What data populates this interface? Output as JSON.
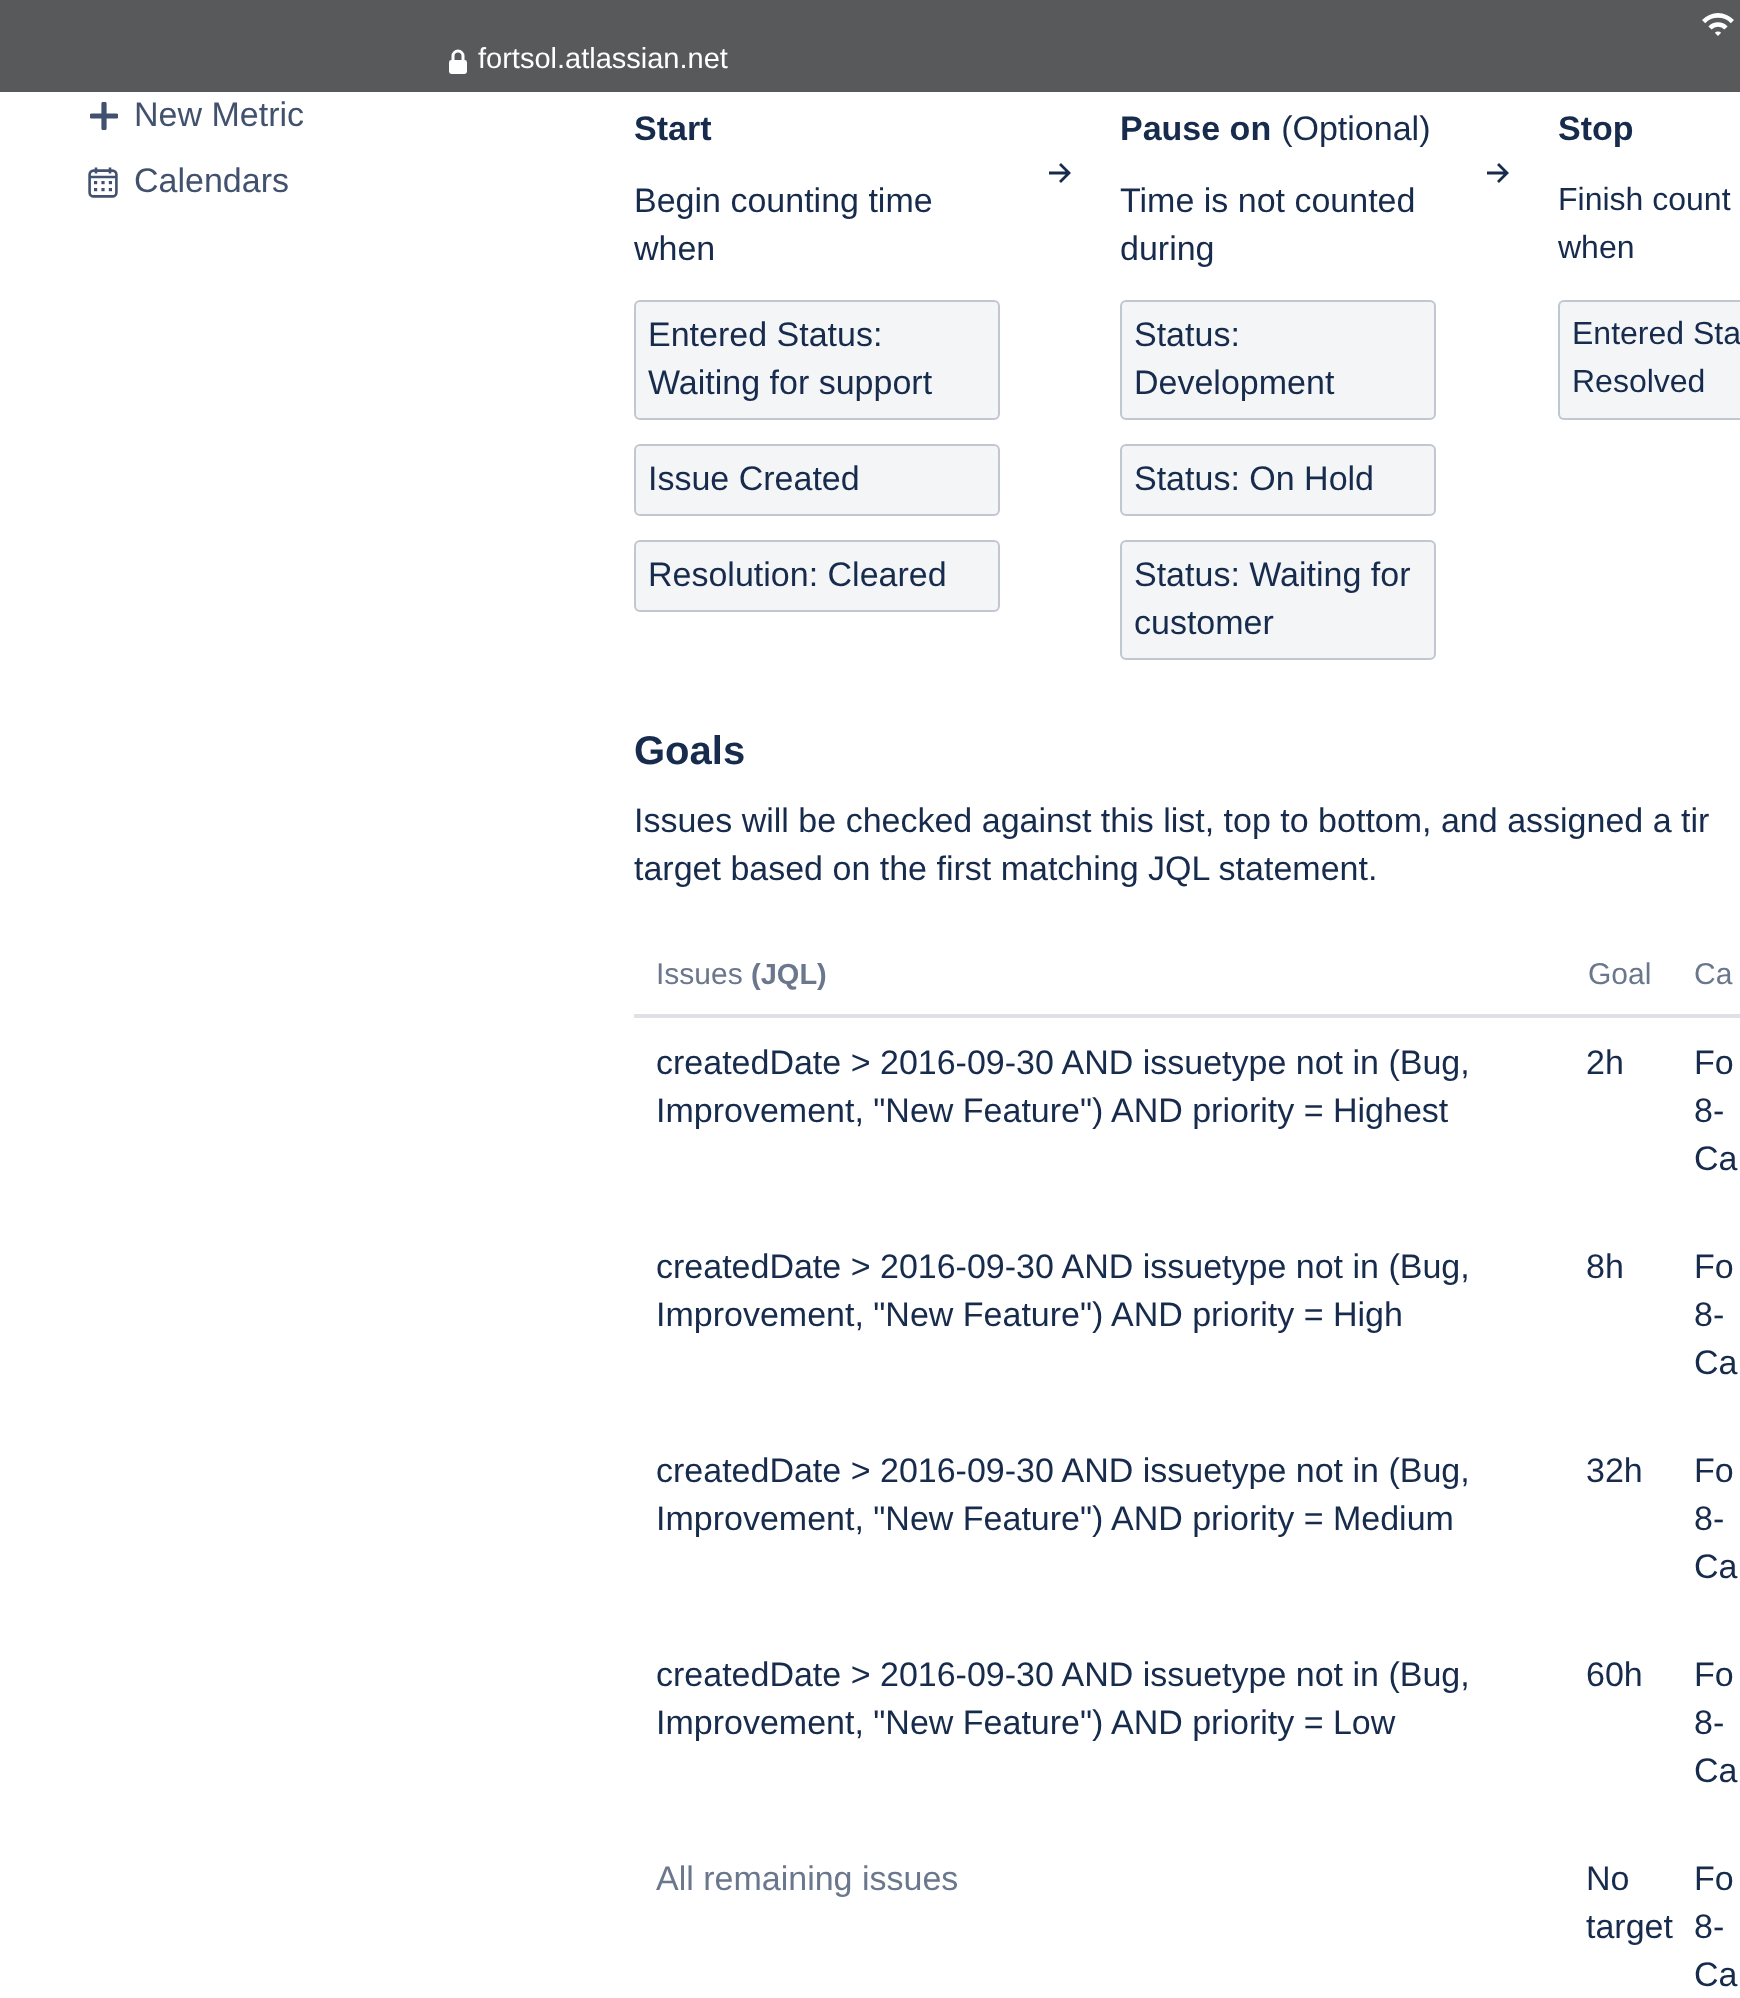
{
  "browser": {
    "url": "fortsol.atlassian.net"
  },
  "sidebar": {
    "items": [
      {
        "label": "New Metric"
      },
      {
        "label": "Calendars"
      }
    ]
  },
  "stages": [
    {
      "title": "Start",
      "description": "Begin counting time\nwhen",
      "conditions": [
        "Entered Status:\nWaiting for support",
        "Issue Created",
        "Resolution: Cleared"
      ]
    },
    {
      "title": "Pause on",
      "note": "(Optional)",
      "description": "Time is not counted\nduring",
      "conditions": [
        "Status:\nDevelopment",
        "Status: On Hold",
        "Status: Waiting for\ncustomer"
      ]
    },
    {
      "title": "Stop",
      "description": "Finish count\nwhen",
      "conditions": [
        "Entered Sta\nResolved"
      ]
    }
  ],
  "goals": {
    "heading": "Goals",
    "description": "Issues will be checked against this list, top to bottom, and assigned a tir\ntarget based on the first matching JQL statement.",
    "table": {
      "columns": [
        "Issues **(JQL)**",
        "Goal",
        "Ca"
      ],
      "rows": [
        {
          "kind": "jql",
          "cells": [
            "createdDate > 2016-09-30 AND issuetype not in (Bug,\nImprovement, \"New Feature\") AND priority = Highest",
            "2h",
            "Fo\n8-\nCa"
          ]
        },
        {
          "kind": "jql",
          "cells": [
            "createdDate > 2016-09-30 AND issuetype not in (Bug,\nImprovement, \"New Feature\") AND priority = High",
            "8h",
            "Fo\n8-\nCa"
          ]
        },
        {
          "kind": "jql",
          "cells": [
            "createdDate > 2016-09-30 AND issuetype not in (Bug,\nImprovement, \"New Feature\") AND priority = Medium",
            "32h",
            "Fo\n8-\nCa"
          ]
        },
        {
          "kind": "jql",
          "cells": [
            "createdDate > 2016-09-30 AND issuetype not in (Bug,\nImprovement, \"New Feature\") AND priority = Low",
            "60h",
            "Fo\n8-\nCa"
          ]
        },
        {
          "kind": "remaining",
          "cells": [
            "All remaining issues",
            "No\ntarget",
            "Fo\n8-\nCa"
          ]
        }
      ]
    }
  }
}
